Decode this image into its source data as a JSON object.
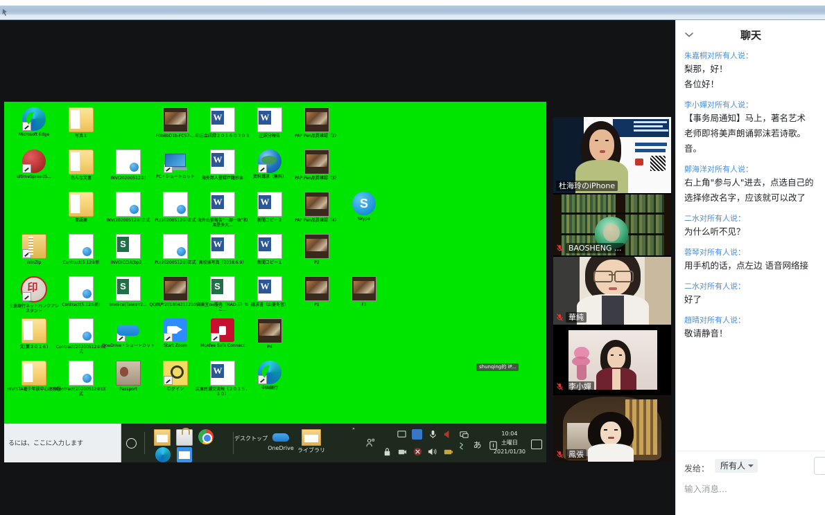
{
  "os": {
    "titlebar_icon": "window-icon",
    "taskbar": {
      "search_placeholder": "るには、ここに入力します",
      "cortana_icon": "circle-icon",
      "pinned": [
        {
          "name": "file-explorer-icon",
          "label": "エクスプローラー"
        },
        {
          "name": "microsoft-store-icon",
          "label": "Microsoft Store"
        },
        {
          "name": "chrome-icon",
          "label": "Google Chrome"
        },
        {
          "name": "edge-icon",
          "label": "Microsoft Edge"
        },
        {
          "name": "mail-icon",
          "label": "メール"
        }
      ],
      "quick_launch": [
        {
          "name": "desktop-toolbar",
          "label": "デスクトップ"
        },
        {
          "name": "onedrive-icon",
          "label": "OneDrive"
        },
        {
          "name": "library-folder-icon",
          "label": "ライブラリ"
        }
      ],
      "tray_icons": [
        "people-icon",
        "monitor-icon",
        "blue-square-icon",
        "microphone-icon",
        "speaker-red-icon",
        "screen-share-icon",
        "lock-icon",
        "camera-icon",
        "mute-icon",
        "volume-icon",
        "battery-icon",
        "bluetooth-icon",
        "ime-a-icon",
        "ime-mode-icon"
      ],
      "clock_time": "10:04",
      "clock_day": "土曜日",
      "clock_date": "2021/01/30",
      "notification_icon": "notification-icon"
    }
  },
  "shared_screen": {
    "background_color": "#00e500",
    "floating_tag": "shunqing的 iP...",
    "desktop_icons": [
      {
        "label": "Microsoft Edge",
        "glyph": "g-edge",
        "shortcut": true,
        "col": 0,
        "row": 0
      },
      {
        "label": "写真１",
        "glyph": "g-folder",
        "shortcut": false,
        "col": 1,
        "row": 0
      },
      {
        "label": "F0b8bD1b-FC57-...",
        "glyph": "g-photo",
        "shortcut": false,
        "col": 3,
        "row": 0
      },
      {
        "label": "印忘会訊録２０１６０３０３",
        "glyph": "g-word",
        "shortcut": false,
        "col": 4,
        "row": 0
      },
      {
        "label": "圧訳分報告",
        "glyph": "g-word",
        "shortcut": false,
        "col": 5,
        "row": 0
      },
      {
        "label": "PAP Pen品質確認（2）",
        "glyph": "g-photo",
        "shortcut": false,
        "col": 6,
        "row": 0
      },
      {
        "label": "ultimeSpreadS...",
        "glyph": "g-redcircle",
        "shortcut": true,
        "col": 0,
        "row": 1
      },
      {
        "label": "色んな文書",
        "glyph": "g-folder",
        "shortcut": false,
        "col": 1,
        "row": 1
      },
      {
        "label": "INV(20200512①)",
        "glyph": "g-pdfish",
        "shortcut": false,
        "col": 2,
        "row": 1
      },
      {
        "label": "PC・ショートカット",
        "glyph": "g-pc",
        "shortcut": true,
        "col": 3,
        "row": 1
      },
      {
        "label": "海外邦人登録戸籍抄本",
        "glyph": "g-word",
        "shortcut": false,
        "col": 4,
        "row": 1
      },
      {
        "label": "資料請求（無料）",
        "glyph": "g-globe",
        "shortcut": true,
        "col": 5,
        "row": 1
      },
      {
        "label": "PAP Pen品質確認（3）",
        "glyph": "g-photo",
        "shortcut": false,
        "col": 6,
        "row": 1
      },
      {
        "label": "単語集",
        "glyph": "g-folder",
        "shortcut": false,
        "col": 1,
        "row": 2
      },
      {
        "label": "INV(20200512①)正式",
        "glyph": "g-pdfish",
        "shortcut": false,
        "col": 2,
        "row": 2
      },
      {
        "label": "PL(20200512①)正式",
        "glyph": "g-pdfish",
        "shortcut": false,
        "col": 3,
        "row": 2
      },
      {
        "label": "海外出張報告“一部一致”和果是多大...",
        "glyph": "g-word",
        "shortcut": false,
        "col": 4,
        "row": 2
      },
      {
        "label": "新聞コピー２",
        "glyph": "g-word",
        "shortcut": false,
        "col": 5,
        "row": 2
      },
      {
        "label": "PAP Pen品質確認（4）",
        "glyph": "g-photo",
        "shortcut": false,
        "col": 6,
        "row": 2
      },
      {
        "label": "Skype",
        "glyph": "g-skype",
        "shortcut": false,
        "col": 7,
        "row": 2
      },
      {
        "label": "WinZip",
        "glyph": "g-winzip",
        "shortcut": true,
        "col": 0,
        "row": 3
      },
      {
        "label": "Contract(5.12①新",
        "glyph": "g-pdfish",
        "shortcut": false,
        "col": 1,
        "row": 3
      },
      {
        "label": "INVOICCIA(bp2...",
        "glyph": "g-excel",
        "shortcut": false,
        "col": 2,
        "row": 3
      },
      {
        "label": "PL(20200512①)正式",
        "glyph": "g-pdfish",
        "shortcut": false,
        "col": 3,
        "row": 3
      },
      {
        "label": "高校振写真（2018.6.9）",
        "glyph": "g-word",
        "shortcut": false,
        "col": 4,
        "row": 3
      },
      {
        "label": "新聞コピー１",
        "glyph": "g-word",
        "shortcut": false,
        "col": 5,
        "row": 3
      },
      {
        "label": "P2",
        "glyph": "g-photo",
        "shortcut": false,
        "col": 6,
        "row": 3
      },
      {
        "label": "三菱銀行ネットバンクアシスタント",
        "glyph": "g-bankicon",
        "shortcut": true,
        "col": 0,
        "row": 4
      },
      {
        "label": "Contract(5.12①新)",
        "glyph": "g-pdfish",
        "shortcut": false,
        "col": 1,
        "row": 4
      },
      {
        "label": "Invoice(Taiwan2...",
        "glyph": "g-excel",
        "shortcut": false,
        "col": 2,
        "row": 4
      },
      {
        "label": "QQ图片20180421121056",
        "glyph": "g-photo",
        "shortcut": false,
        "col": 3,
        "row": 4
      },
      {
        "label": "広東宜он服务（HAO-5）ちこ...",
        "glyph": "g-excel",
        "shortcut": false,
        "col": 4,
        "row": 4
      },
      {
        "label": "請求書（山菱冬音）",
        "glyph": "g-word",
        "shortcut": false,
        "col": 5,
        "row": 4
      },
      {
        "label": "P1",
        "glyph": "g-photo",
        "shortcut": false,
        "col": 6,
        "row": 4
      },
      {
        "label": "F3",
        "glyph": "g-photo",
        "shortcut": false,
        "col": 7,
        "row": 4
      },
      {
        "label": "文(業２０１６)",
        "glyph": "g-folder",
        "shortcut": false,
        "col": 0,
        "row": 5
      },
      {
        "label": "Contract(20200512①)正式",
        "glyph": "g-pdfish",
        "shortcut": false,
        "col": 1,
        "row": 5
      },
      {
        "label": "OneDrive・ショートカット",
        "glyph": "g-onedrive",
        "shortcut": true,
        "col": 2,
        "row": 5
      },
      {
        "label": "Start Zoom",
        "glyph": "g-zoomcam",
        "shortcut": true,
        "col": 3,
        "row": 5
      },
      {
        "label": "McAfee Safe Connect",
        "glyph": "g-mcafee",
        "shortcut": true,
        "col": 4,
        "row": 5
      },
      {
        "label": "P4",
        "glyph": "g-photo",
        "shortcut": false,
        "col": 5,
        "row": 5
      },
      {
        "label": "HIVISTA著少年放中心理療程",
        "glyph": "g-folder",
        "shortcut": false,
        "col": 0,
        "row": 6
      },
      {
        "label": "Contract(20200512②)正式",
        "glyph": "g-pdfish",
        "shortcut": false,
        "col": 1,
        "row": 6
      },
      {
        "label": "Passport",
        "glyph": "g-passport",
        "shortcut": false,
        "col": 2,
        "row": 6
      },
      {
        "label": "ログイン",
        "glyph": "g-key",
        "shortcut": true,
        "col": 3,
        "row": 6
      },
      {
        "label": "広東民潮交流報（２０１５．１０）",
        "glyph": "g-word",
        "shortcut": false,
        "col": 4,
        "row": 6
      },
      {
        "label": "中国銀行",
        "glyph": "g-edge",
        "shortcut": true,
        "col": 5,
        "row": 6
      }
    ]
  },
  "participants": [
    {
      "name": "杜海玲のiPhone",
      "active": true,
      "muted": false,
      "scene": "phone-banner"
    },
    {
      "name": "BAOSHENG ...",
      "active": false,
      "muted": true,
      "scene": "bookshelf"
    },
    {
      "name": "華純",
      "active": false,
      "muted": true,
      "scene": "glasses-room"
    },
    {
      "name": "李小嬋",
      "active": false,
      "muted": true,
      "scene": "flowers-room"
    },
    {
      "name": "鳳張",
      "active": false,
      "muted": true,
      "scene": "kitchen"
    }
  ],
  "chat": {
    "title": "聊天",
    "collapse_icon": "chevron-down-icon",
    "messages": [
      {
        "from": "朱嘉桐对所有人说：",
        "lines": [
          "梨那，好！",
          "各位好！"
        ]
      },
      {
        "from": "李小嬋对所有人说：",
        "lines": [
          "【事务局通知】马上，著名艺术",
          "老师即将美声朗诵郭沫若诗歌。",
          "音。"
        ]
      },
      {
        "from": "鄭海洋对所有人说：",
        "lines": [
          "右上角\"参与人\"进去，点选自己的",
          "选择修改名字，应该就可以改了"
        ]
      },
      {
        "from": "二水对所有人说：",
        "lines": [
          "为什么听不见？"
        ]
      },
      {
        "from": "蓉琴对所有人说：",
        "lines": [
          "用手机的话，点左边 语音网络接"
        ]
      },
      {
        "from": "二水对所有人说：",
        "lines": [
          "好了"
        ]
      },
      {
        "from": "趙晴对所有人说：",
        "lines": [
          "敬请静音！"
        ]
      }
    ],
    "footer": {
      "send_to_label": "发给：",
      "send_to_value": "所有人",
      "caret_icon": "chevron-down-icon",
      "more_button_icon": "ellipsis-icon",
      "input_placeholder": "输入消息..."
    }
  },
  "colors": {
    "chroma_green": "#00e500",
    "chat_from": "#4d8fd6",
    "active_speaker_border": "#a6e22e",
    "zoom_dark": "#111315"
  }
}
